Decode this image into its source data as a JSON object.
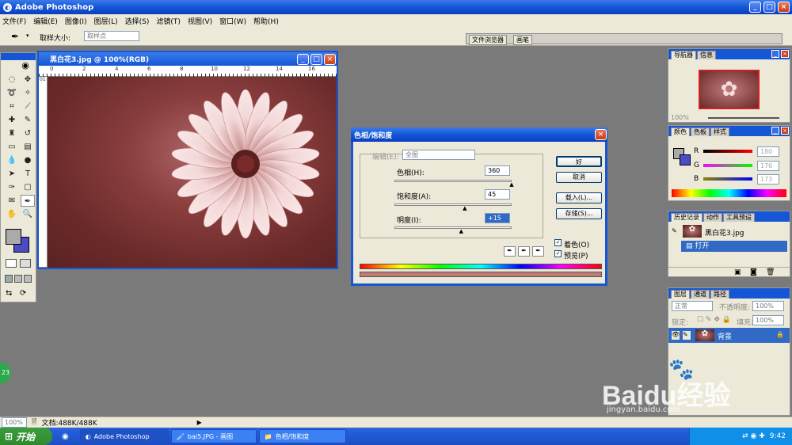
{
  "app": {
    "title": "Adobe Photoshop",
    "window_buttons": [
      "_",
      "□",
      "×"
    ]
  },
  "menu": [
    "文件(F)",
    "编辑(E)",
    "图像(I)",
    "图层(L)",
    "选择(S)",
    "滤镜(T)",
    "视图(V)",
    "窗口(W)",
    "帮助(H)"
  ],
  "options": {
    "sample_size_label": "取样大小:",
    "sample_size_value": "取样点",
    "tabs": [
      "文件浏览器",
      "画笔"
    ]
  },
  "document": {
    "title": "黑白花3.jpg @ 100%(RGB)",
    "ruler_ticks": [
      "0",
      "2",
      "4",
      "6",
      "8",
      "10",
      "12",
      "14",
      "16"
    ],
    "corner_label": "01"
  },
  "dialog": {
    "title": "色相/饱和度",
    "edit_label": "编辑(E):",
    "edit_value": "全图",
    "hue_label": "色相(H):",
    "hue_value": "360",
    "hue_pos": 1.0,
    "sat_label": "饱和度(A):",
    "sat_value": "45",
    "sat_pos": 0.6,
    "light_label": "明度(I):",
    "light_value": "+15",
    "light_pos": 0.57,
    "ok": "好",
    "cancel": "取消",
    "load": "载入(L)...",
    "save": "存储(S)...",
    "colorize": "着色(O)",
    "preview": "预览(P)",
    "colorize_checked": true,
    "preview_checked": true,
    "result_color": "#c07a78"
  },
  "navigator": {
    "tabs": [
      "导航器",
      "信息"
    ],
    "zoom": "100%"
  },
  "color_panel": {
    "tabs": [
      "颜色",
      "色板",
      "样式"
    ],
    "r": "180",
    "g": "176",
    "b": "173"
  },
  "history": {
    "tabs": [
      "历史记录",
      "动作",
      "工具预设"
    ],
    "snapshot": "黑白花3.jpg",
    "step": "打开"
  },
  "layers": {
    "tabs": [
      "图层",
      "通道",
      "路径"
    ],
    "blend": "正常",
    "opacity_label": "不透明度:",
    "opacity": "100%",
    "lock_label": "锁定:",
    "fill_label": "填充:",
    "fill": "100%",
    "layer_name": "背景"
  },
  "status": {
    "zoom": "100%",
    "doc": "文档:488K/488K"
  },
  "taskbar": {
    "start": "开始",
    "tasks": [
      "Adobe Photoshop",
      "bai5.JPG - 画图",
      "色相/饱和度"
    ],
    "time": "9:42"
  },
  "watermark": {
    "brand": "Baidu经验",
    "url": "jingyan.baidu.com"
  },
  "badge": "23",
  "colors": {
    "xp_blue": "#1456d6",
    "panel_bg": "#ece9d8",
    "canvas": "#7a7a7a",
    "flower": "#f3d8d8"
  }
}
